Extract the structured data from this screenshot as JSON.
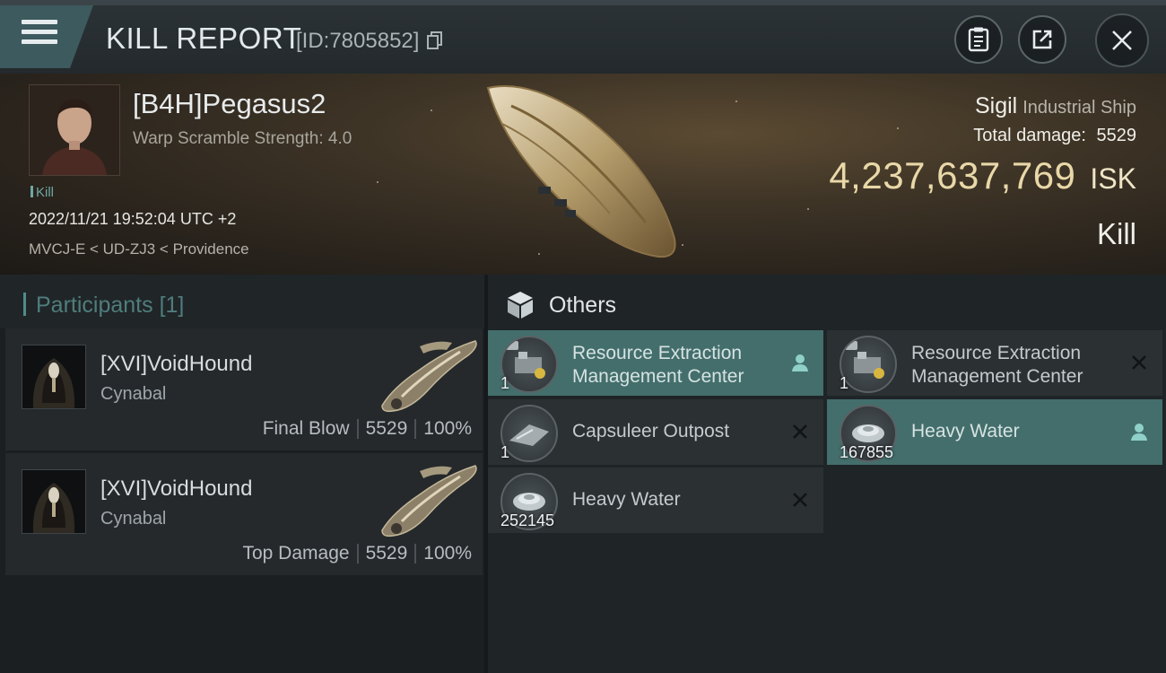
{
  "header": {
    "title": "KILL REPORT",
    "report_id": "[ID:7805852]",
    "icons": {
      "menu": "hamburger-icon",
      "clip": "clipboard-icon",
      "share": "share-icon",
      "close": "close-icon"
    }
  },
  "victim": {
    "pilot": "[B4H]Pegasus2",
    "warp_scramble": "Warp Scramble Strength: 4.0",
    "kill_tag": "Kill",
    "datetime": "2022/11/21 19:52:04 UTC +2",
    "location": "MVCJ-E < UD-ZJ3 < Providence",
    "ship_name": "Sigil",
    "ship_class": "Industrial Ship",
    "total_damage_label": "Total damage:",
    "total_damage": "5529",
    "isk_value": "4,237,637,769",
    "isk_unit": "ISK",
    "result": "Kill"
  },
  "participants": {
    "title": "Participants",
    "count": "[1]",
    "rows": [
      {
        "pilot": "[XVI]VoidHound",
        "ship": "Cynabal",
        "role": "Final Blow",
        "damage": "5529",
        "percent": "100%"
      },
      {
        "pilot": "[XVI]VoidHound",
        "ship": "Cynabal",
        "role": "Top Damage",
        "damage": "5529",
        "percent": "100%"
      }
    ]
  },
  "others": {
    "title": "Others",
    "items": [
      {
        "name": "Resource Extraction Management Center",
        "qty": "1",
        "selected": true,
        "action": "person-icon"
      },
      {
        "name": "Resource Extraction Management Center",
        "qty": "1",
        "selected": false,
        "action": "close-icon"
      },
      {
        "name": "Capsuleer Outpost",
        "qty": "1",
        "selected": false,
        "action": "close-icon"
      },
      {
        "name": "Heavy Water",
        "qty": "167855",
        "selected": true,
        "action": "person-icon"
      },
      {
        "name": "Heavy Water",
        "qty": "252145",
        "selected": false,
        "action": "close-icon"
      }
    ]
  },
  "colors": {
    "accent_teal": "#436e6c",
    "isk_gold": "#e9d8a8",
    "kill_teal": "#6fa7a4"
  }
}
